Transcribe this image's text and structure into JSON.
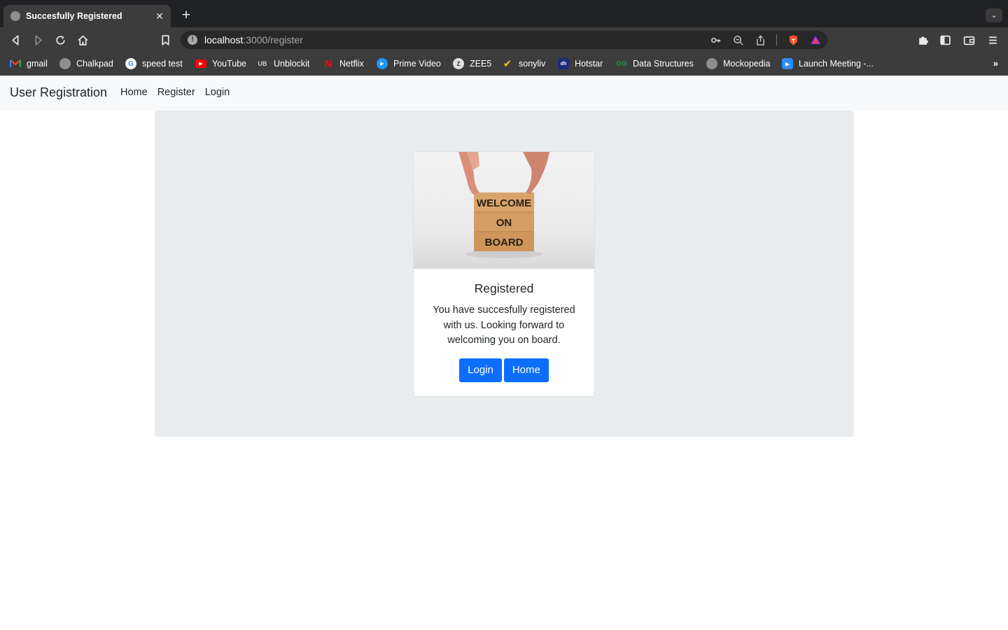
{
  "browser": {
    "tab": {
      "title": "Succesfully Registered",
      "close_glyph": "✕"
    },
    "new_tab_glyph": "+",
    "tab_list_glyph": "⌄",
    "url": {
      "host": "localhost",
      "rest": ":3000/register"
    },
    "bookmarks_more_glyph": "»",
    "bookmarks": [
      {
        "label": "gmail",
        "icon": "gmail-icon",
        "color": "#ea4335"
      },
      {
        "label": "Chalkpad",
        "icon": "globe-icon",
        "color": "#8e8e8e"
      },
      {
        "label": "speed test",
        "icon": "google-icon",
        "color": "#ffffff"
      },
      {
        "label": "YouTube",
        "icon": "youtube-icon",
        "color": "#ff0000"
      },
      {
        "label": "Unblockit",
        "icon": "unblockit-icon",
        "color": "#777777"
      },
      {
        "label": "Netflix",
        "icon": "netflix-icon",
        "color": "#e50914"
      },
      {
        "label": "Prime Video",
        "icon": "prime-video-icon",
        "color": "#1a98ff"
      },
      {
        "label": "ZEE5",
        "icon": "zee5-icon",
        "color": "#555555"
      },
      {
        "label": "sonyliv",
        "icon": "sonyliv-icon",
        "color": "#f5c518"
      },
      {
        "label": "Hotstar",
        "icon": "hotstar-icon",
        "color": "#1f2a7a"
      },
      {
        "label": "Data Structures",
        "icon": "gfg-icon",
        "color": "#2f8d46"
      },
      {
        "label": "Mockopedia",
        "icon": "globe-icon",
        "color": "#8e8e8e"
      },
      {
        "label": "Launch Meeting -...",
        "icon": "zoom-icon",
        "color": "#2d8cff"
      }
    ]
  },
  "navbar": {
    "brand": "User Registration",
    "links": [
      "Home",
      "Register",
      "Login"
    ]
  },
  "card": {
    "image_text": [
      "WELCOME",
      "ON",
      "BOARD"
    ],
    "title": "Registered",
    "text": "You have succesfully registered with us. Looking forward to welcoming you on board.",
    "buttons": {
      "login": "Login",
      "home": "Home"
    }
  },
  "colors": {
    "primary": "#0d6efd",
    "jumbotron": "#e9ecef",
    "navbar": "#f8f9fa"
  }
}
